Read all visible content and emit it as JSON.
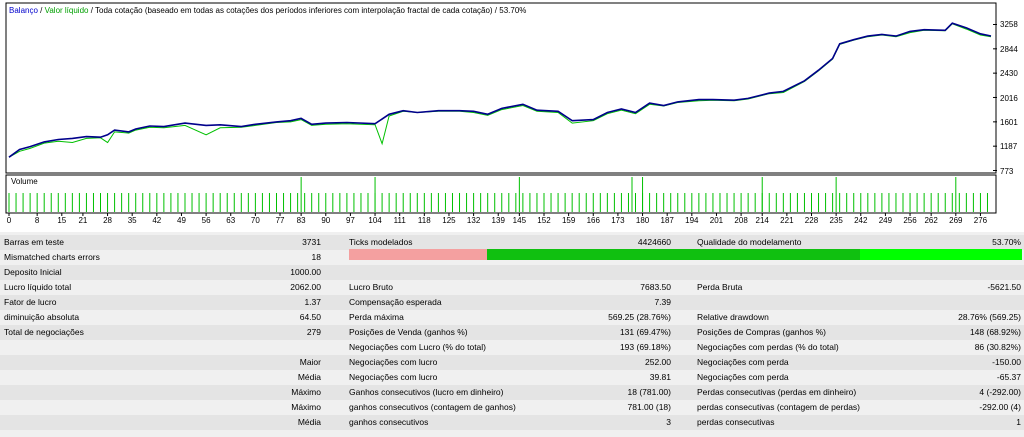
{
  "chart": {
    "legend_balance": "Balanço",
    "legend_separator1": " / ",
    "legend_equity": "Valor líquido",
    "legend_rest": " / Toda cotação (baseado em todas as cotações dos períodos inferiores com interpolação fractal de cada cotação) / 53.70%",
    "volume_label": "Volume",
    "y_ticks": [
      "3258",
      "2844",
      "2430",
      "2016",
      "1601",
      "1187",
      "773"
    ],
    "x_ticks": [
      "0",
      "8",
      "15",
      "21",
      "28",
      "35",
      "42",
      "49",
      "56",
      "63",
      "70",
      "77",
      "83",
      "90",
      "97",
      "104",
      "111",
      "118",
      "125",
      "132",
      "139",
      "145",
      "152",
      "159",
      "166",
      "173",
      "180",
      "187",
      "194",
      "201",
      "208",
      "214",
      "221",
      "228",
      "235",
      "242",
      "249",
      "256",
      "262",
      "269",
      "276"
    ],
    "colors": {
      "balance": "#00008b",
      "equity": "#00c000",
      "volume": "#00c000",
      "legend_balance": "#0000cc",
      "legend_equity": "#00a000"
    }
  },
  "chart_data": {
    "type": "line",
    "xlabel": "",
    "ylabel": "",
    "x_range": [
      0,
      279
    ],
    "ylim": [
      773,
      3258
    ],
    "series": [
      {
        "name": "Balanço",
        "x": [
          0,
          3,
          6,
          10,
          14,
          18,
          22,
          26,
          28,
          30,
          34,
          36,
          40,
          44,
          50,
          56,
          60,
          66,
          70,
          76,
          80,
          83,
          86,
          90,
          96,
          104,
          108,
          112,
          116,
          122,
          128,
          132,
          136,
          140,
          146,
          150,
          156,
          160,
          166,
          170,
          174,
          178,
          182,
          186,
          190,
          196,
          200,
          206,
          210,
          216,
          220,
          226,
          230,
          234,
          236,
          240,
          244,
          248,
          252,
          256,
          260,
          266,
          268,
          272,
          276,
          279
        ],
        "y": [
          1000,
          1130,
          1180,
          1260,
          1300,
          1320,
          1350,
          1340,
          1380,
          1460,
          1430,
          1480,
          1530,
          1520,
          1580,
          1540,
          1550,
          1520,
          1560,
          1600,
          1620,
          1660,
          1560,
          1580,
          1590,
          1570,
          1730,
          1790,
          1760,
          1790,
          1790,
          1780,
          1730,
          1830,
          1900,
          1800,
          1780,
          1620,
          1640,
          1760,
          1820,
          1760,
          1920,
          1880,
          1940,
          1980,
          1980,
          1970,
          2000,
          2090,
          2120,
          2300,
          2480,
          2680,
          2930,
          3000,
          3060,
          3090,
          3060,
          3140,
          3170,
          3160,
          3280,
          3200,
          3100,
          3062
        ]
      },
      {
        "name": "Valor líquido",
        "x": [
          0,
          3,
          6,
          10,
          14,
          18,
          22,
          26,
          28,
          30,
          34,
          36,
          40,
          44,
          50,
          56,
          60,
          66,
          70,
          76,
          80,
          83,
          86,
          90,
          96,
          104,
          106,
          108,
          112,
          116,
          122,
          128,
          132,
          136,
          140,
          146,
          150,
          156,
          160,
          166,
          170,
          174,
          178,
          182,
          186,
          190,
          196,
          200,
          206,
          210,
          216,
          220,
          226,
          230,
          234,
          236,
          240,
          244,
          248,
          252,
          256,
          260,
          266,
          268,
          272,
          276,
          279
        ],
        "y": [
          1000,
          1100,
          1150,
          1240,
          1270,
          1250,
          1320,
          1330,
          1250,
          1430,
          1410,
          1460,
          1510,
          1500,
          1540,
          1380,
          1500,
          1510,
          1540,
          1590,
          1600,
          1640,
          1540,
          1560,
          1570,
          1550,
          1230,
          1700,
          1780,
          1760,
          1780,
          1780,
          1760,
          1710,
          1810,
          1880,
          1780,
          1760,
          1580,
          1620,
          1740,
          1800,
          1740,
          1900,
          1870,
          1930,
          1960,
          1970,
          1960,
          1990,
          2080,
          2100,
          2290,
          2470,
          2670,
          2920,
          2990,
          3050,
          3080,
          3050,
          3120,
          3160,
          3150,
          3270,
          3180,
          3080,
          3050
        ]
      }
    ],
    "volume_bars_x": [
      0,
      2,
      4,
      6,
      8,
      10,
      12,
      14,
      16,
      18,
      20,
      22,
      24,
      26,
      28,
      30,
      32,
      34,
      36,
      38,
      40,
      42,
      44,
      46,
      48,
      50,
      52,
      54,
      56,
      58,
      60,
      62,
      64,
      66,
      68,
      70,
      72,
      74,
      76,
      78,
      80,
      82,
      84,
      86,
      88,
      90,
      92,
      94,
      96,
      98,
      100,
      102,
      104,
      106,
      108,
      110,
      112,
      114,
      116,
      118,
      120,
      122,
      124,
      126,
      128,
      130,
      132,
      134,
      136,
      138,
      140,
      142,
      144,
      146,
      148,
      150,
      152,
      154,
      156,
      158,
      160,
      162,
      164,
      166,
      168,
      170,
      172,
      174,
      176,
      178,
      180,
      182,
      184,
      186,
      188,
      190,
      192,
      194,
      196,
      198,
      200,
      202,
      204,
      206,
      208,
      210,
      212,
      214,
      216,
      218,
      220,
      222,
      224,
      226,
      228,
      230,
      232,
      234,
      236,
      238,
      240,
      242,
      244,
      246,
      248,
      250,
      252,
      254,
      256,
      258,
      260,
      262,
      264,
      266,
      268,
      270,
      272,
      274,
      276,
      278
    ],
    "volume_tall_x": [
      83,
      104,
      145,
      177,
      180,
      214,
      235,
      269
    ]
  },
  "stats": {
    "bars_label": "Barras em teste",
    "bars_value": "3731",
    "ticks_label": "Ticks modelados",
    "ticks_value": "4424660",
    "quality_label": "Qualidade do modelamento",
    "quality_value": "53.70%",
    "mismatch_label": "Mismatched charts errors",
    "mismatch_value": "18",
    "quality_bar": {
      "red_fraction": 0.205,
      "green_fraction": 0.555,
      "lime_fraction": 0.24
    },
    "deposit_label": "Deposito Inicial",
    "deposit_value": "1000.00",
    "net_label": "Lucro líquido total",
    "net_value": "2062.00",
    "gross_profit_label": "Lucro Bruto",
    "gross_profit_value": "7683.50",
    "gross_loss_label": "Perda Bruta",
    "gross_loss_value": "-5621.50",
    "pf_label": "Fator de lucro",
    "pf_value": "1.37",
    "expected_label": "Compensação esperada",
    "expected_value": "7.39",
    "abs_dd_label": "diminuição absoluta",
    "abs_dd_value": "64.50",
    "max_dd_label": "Perda máxima",
    "max_dd_value": "569.25 (28.76%)",
    "rel_dd_label": "Relative drawdown",
    "rel_dd_value": "28.76% (569.25)",
    "trades_label": "Total de negociações",
    "trades_value": "279",
    "short_label": "Posições de Venda (ganhos %)",
    "short_value": "131 (69.47%)",
    "long_label": "Posições de Compras (ganhos %)",
    "long_value": "148 (68.92%)",
    "profit_trades_label": "Negociações com Lucro (% do total)",
    "profit_trades_value": "193 (69.18%)",
    "loss_trades_label": "Negociações com perdas (% do total)",
    "loss_trades_value": "86 (30.82%)",
    "largest_label": "Maior",
    "largest_profit_label": "Negociações com lucro",
    "largest_profit_value": "252.00",
    "largest_loss_label": "Negociações com perda",
    "largest_loss_value": "-150.00",
    "avg_label": "Média",
    "avg_profit_label": "Negociações com lucro",
    "avg_profit_value": "39.81",
    "avg_loss_label": "Negociações com perda",
    "avg_loss_value": "-65.37",
    "max1_label": "Máximo",
    "cons_wins_money_label": "Ganhos consecutivos (lucro em dinheiro)",
    "cons_wins_money_value": "18 (781.00)",
    "cons_loss_money_label": "Perdas consecutivas (perdas em dinheiro)",
    "cons_loss_money_value": "4 (-292.00)",
    "max2_label": "Máximo",
    "cons_wins_count_label": "ganhos consecutivos (contagem de ganhos)",
    "cons_wins_count_value": "781.00 (18)",
    "cons_loss_count_label": "perdas consecutivas (contagem de perdas)",
    "cons_loss_count_value": "-292.00 (4)",
    "avg2_label": "Média",
    "avg_cons_wins_label": "ganhos consecutivos",
    "avg_cons_wins_value": "3",
    "avg_cons_loss_label": "perdas consecutivas",
    "avg_cons_loss_value": "1"
  }
}
